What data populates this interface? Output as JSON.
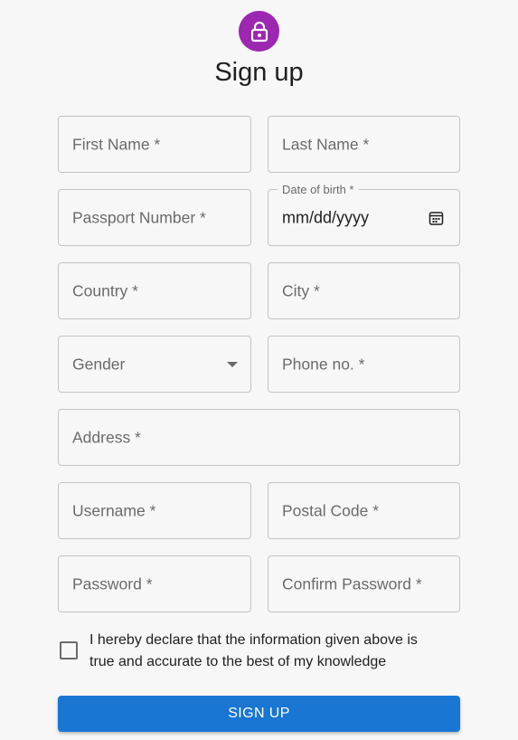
{
  "header": {
    "title": "Sign up",
    "icon": "lock-icon",
    "accent_color": "#9c27b0"
  },
  "form": {
    "first_name": {
      "placeholder": "First Name *"
    },
    "last_name": {
      "placeholder": "Last Name *"
    },
    "passport_number": {
      "placeholder": "Passport Number *"
    },
    "date_of_birth": {
      "label": "Date of birth *",
      "value": "mm/dd/yyyy"
    },
    "country": {
      "placeholder": "Country *"
    },
    "city": {
      "placeholder": "City *"
    },
    "gender": {
      "placeholder": "Gender"
    },
    "phone": {
      "placeholder": "Phone no. *"
    },
    "address": {
      "placeholder": "Address *"
    },
    "username": {
      "placeholder": "Username *"
    },
    "postal_code": {
      "placeholder": "Postal Code *"
    },
    "password": {
      "placeholder": "Password *"
    },
    "confirm_password": {
      "placeholder": "Confirm Password *"
    },
    "declaration": {
      "checked": false,
      "text": "I hereby declare that the information given above is true and accurate to the best of my knowledge"
    },
    "submit_label": "SIGN UP",
    "submit_color": "#1976d2"
  }
}
